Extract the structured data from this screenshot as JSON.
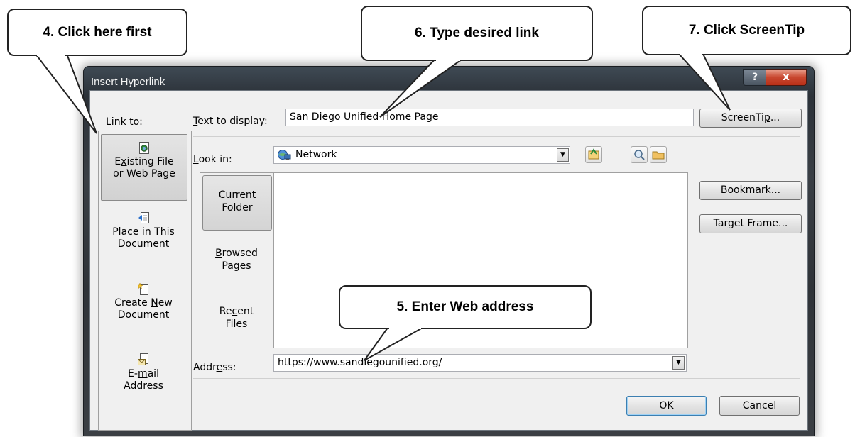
{
  "window": {
    "title": "Insert Hyperlink",
    "help_label": "?",
    "close_label": "x"
  },
  "link_to": {
    "header": "Link to:",
    "items": [
      {
        "pre": "E",
        "ul": "x",
        "post": "isting File",
        "line2": "or Web Page",
        "icon": "web-page-icon",
        "active": true
      },
      {
        "pre": "Pl",
        "ul": "a",
        "post": "ce in This",
        "line2": "Document",
        "icon": "place-in-document-icon",
        "active": false
      },
      {
        "pre": "Create ",
        "ul": "N",
        "post": "ew",
        "line2": "Document",
        "icon": "new-document-icon",
        "active": false
      },
      {
        "pre": "E-",
        "ul": "m",
        "post": "ail",
        "line2": "Address",
        "icon": "email-icon",
        "active": false
      }
    ]
  },
  "text_to_display": {
    "label_ul": "T",
    "label_rest": "ext to display:",
    "value": "San Diego Unified Home Page"
  },
  "look_in": {
    "label_ul": "L",
    "label_rest": "ook in:",
    "value": "Network",
    "icon": "network-icon"
  },
  "toolbar_icons": [
    "browse-web-icon",
    "search-web-icon",
    "open-folder-icon"
  ],
  "folder_tabs": [
    {
      "pre": "C",
      "ul": "u",
      "post": "rrent",
      "line2": "Folder",
      "active": true
    },
    {
      "pre": "",
      "ul": "B",
      "post": "rowsed",
      "line2": "Pages",
      "active": false
    },
    {
      "pre": "Re",
      "ul": "c",
      "post": "ent",
      "line2": "Files",
      "active": false
    }
  ],
  "address": {
    "label_pre": "Addr",
    "label_ul": "e",
    "label_post": "ss:",
    "value": "https://www.sandiegounified.org/"
  },
  "buttons": {
    "screentip": {
      "pre": "ScreenTi",
      "ul": "p",
      "post": "..."
    },
    "bookmark": {
      "pre": "B",
      "ul": "o",
      "post": "okmark..."
    },
    "target_frame": {
      "pre": "Tar",
      "ul": "g",
      "post": "et Frame..."
    },
    "ok": "OK",
    "cancel": "Cancel"
  },
  "callouts": {
    "step4": "4. Click here first",
    "step5": "5. Enter Web address",
    "step6": "6. Type desired link",
    "step7": "7. Click ScreenTip"
  },
  "colors": {
    "callout_border": "#222222",
    "dialog_bg": "#f0f0f0",
    "close_red": "#c8472f"
  }
}
